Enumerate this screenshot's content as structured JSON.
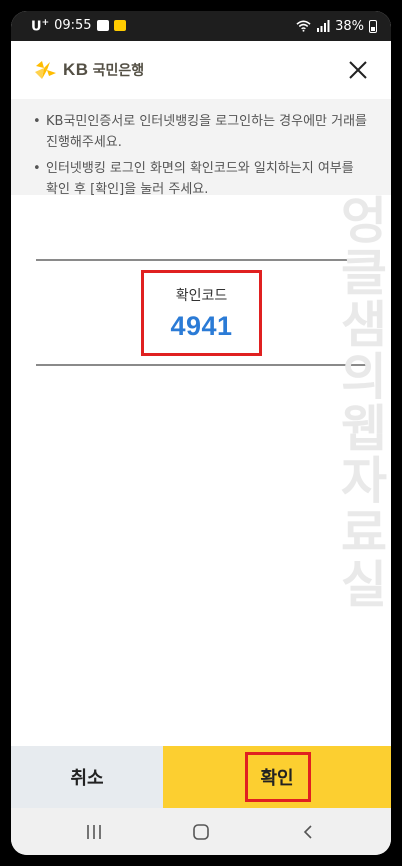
{
  "status_bar": {
    "carrier": "U",
    "carrier_sup": "+",
    "time": "09:55",
    "battery": "38%"
  },
  "header": {
    "logo_kb": "KB",
    "logo_name": "국민은행",
    "close_icon": "close-icon"
  },
  "notice": {
    "bullet": "•",
    "items": [
      "KB국민인증서로 인터넷뱅킹을 로그인하는 경우에만 거래를 진행해주세요.",
      "인터넷뱅킹 로그인 화면의 확인코드와 일치하는지 여부를 확인 후 [확인]을 눌러 주세요."
    ]
  },
  "confirm_code": {
    "label": "확인코드",
    "value": "4941"
  },
  "watermark": "엉클샘의웹자료실",
  "buttons": {
    "cancel": "취소",
    "confirm": "확인"
  },
  "nav": {
    "recent": "recents-icon",
    "home": "home-icon",
    "back": "back-icon"
  },
  "colors": {
    "brand_yellow": "#fccf30",
    "code_blue": "#2b7bd6",
    "highlight_red": "#e02020",
    "cancel_gray": "#e7ebef"
  }
}
